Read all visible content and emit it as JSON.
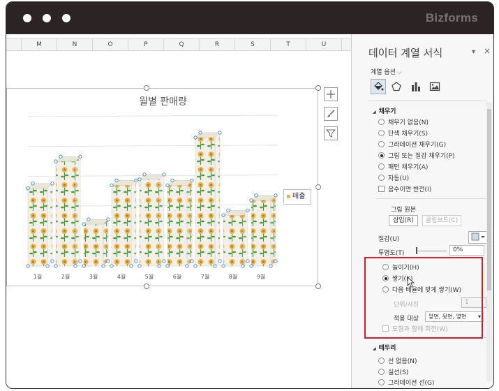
{
  "window": {
    "brand": "Bizforms"
  },
  "sheet": {
    "columns": [
      "M",
      "N",
      "O",
      "P",
      "Q",
      "R",
      "S",
      "T",
      "U"
    ]
  },
  "chart": {
    "legend_label": "매출"
  },
  "chart_data": {
    "type": "bar",
    "title": "월별 판매량",
    "categories": [
      "1월",
      "2월",
      "3월",
      "4월",
      "5월",
      "6월",
      "7월",
      "8월",
      "9월"
    ],
    "series": [
      {
        "name": "매출",
        "values": [
          2.6,
          3.5,
          1.4,
          2.7,
          2.9,
          2.7,
          4.3,
          1.7,
          2.2
        ]
      }
    ],
    "ylim": [
      0,
      5
    ],
    "fill": "picture (flower), stacked"
  },
  "pane": {
    "title": "데이터 계열 서식",
    "options_label": "계열 옵션",
    "fill_section": "채우기",
    "fill_options": [
      "채우기 없음(N)",
      "단색 채우기(S)",
      "그라데이션 채우기(G)",
      "그림 또는 질감 채우기(P)",
      "패턴 채우기(A)",
      "자동(U)"
    ],
    "fill_selected": 3,
    "invert_if_negative": "음수이면 반전(I)",
    "picture_source": "그림 원본",
    "insert_button": "삽입(R)",
    "clipboard_button": "클립보드(C)",
    "texture_label": "질감(U)",
    "transparency_label": "투명도(T)",
    "transparency_value": "0%",
    "stretch_option": "늘이기(H)",
    "stack_option": "쌓기(K)",
    "stack_scale_option": "다음 배율에 맞게 쌓기(W)",
    "units_label": "단위/사진",
    "units_value": "1",
    "apply_to_label": "적용 대상",
    "apply_to_value": "앞면, 뒷면, 옆면",
    "rotate_with_shape": "도형과 함께 회전(W)",
    "border_section": "테두리",
    "border_options": [
      "선 없음(N)",
      "실선(S)",
      "그라데이션 선(G)"
    ],
    "colors": {
      "highlight": "#d61f26",
      "flower": "#e6b84a",
      "stem": "#4c9a3c"
    }
  }
}
